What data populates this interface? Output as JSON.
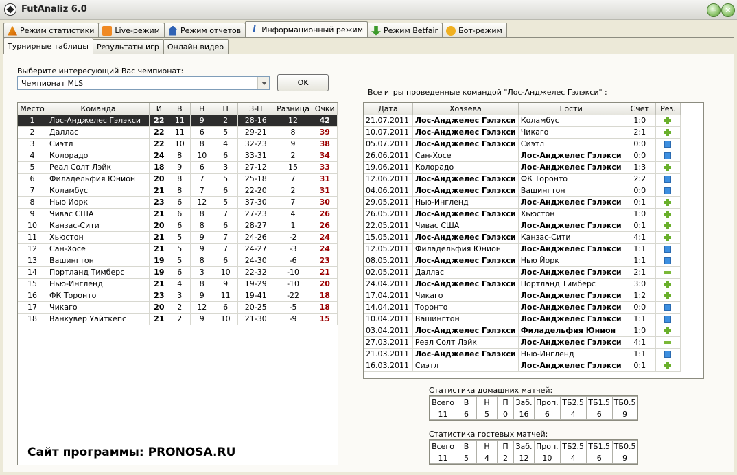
{
  "window": {
    "title": "FutAnaliz 6.0",
    "minimize": "−",
    "maximize": "+",
    "close": "×"
  },
  "main_tabs": [
    {
      "label": "Режим статистики",
      "icon": "warning-icon"
    },
    {
      "label": "Live-режим",
      "icon": "rss-icon"
    },
    {
      "label": "Режим отчетов",
      "icon": "home-icon"
    },
    {
      "label": "Информационный режим",
      "icon": "info-icon"
    },
    {
      "label": "Режим Betfair",
      "icon": "down-arrow-icon"
    },
    {
      "label": "Бот-режим",
      "icon": "chat-icon"
    }
  ],
  "sub_tabs": [
    {
      "label": "Турнирные таблицы"
    },
    {
      "label": "Результаты игр"
    },
    {
      "label": "Онлайн видео"
    }
  ],
  "championship": {
    "prompt": "Выберите интересующий Вас чемпионат:",
    "selected": "Чемпионат MLS",
    "ok_label": "OK"
  },
  "standings": {
    "headers": [
      "Место",
      "Команда",
      "И",
      "В",
      "Н",
      "П",
      "З-П",
      "Разница",
      "Очки"
    ],
    "rows": [
      [
        "1",
        "Лос-Анджелес Гэлэкси",
        "22",
        "11",
        "9",
        "2",
        "28-16",
        "12",
        "42"
      ],
      [
        "2",
        "Даллас",
        "22",
        "11",
        "6",
        "5",
        "29-21",
        "8",
        "39"
      ],
      [
        "3",
        "Сиэтл",
        "22",
        "10",
        "8",
        "4",
        "32-23",
        "9",
        "38"
      ],
      [
        "4",
        "Колорадо",
        "24",
        "8",
        "10",
        "6",
        "33-31",
        "2",
        "34"
      ],
      [
        "5",
        "Реал Солт Лэйк",
        "18",
        "9",
        "6",
        "3",
        "27-12",
        "15",
        "33"
      ],
      [
        "6",
        "Филадельфия Юнион",
        "20",
        "8",
        "7",
        "5",
        "25-18",
        "7",
        "31"
      ],
      [
        "7",
        "Коламбус",
        "21",
        "8",
        "7",
        "6",
        "22-20",
        "2",
        "31"
      ],
      [
        "8",
        "Нью Йорк",
        "23",
        "6",
        "12",
        "5",
        "37-30",
        "7",
        "30"
      ],
      [
        "9",
        "Чивас США",
        "21",
        "6",
        "8",
        "7",
        "27-23",
        "4",
        "26"
      ],
      [
        "10",
        "Канзас-Сити",
        "20",
        "6",
        "8",
        "6",
        "28-27",
        "1",
        "26"
      ],
      [
        "11",
        "Хьюстон",
        "21",
        "5",
        "9",
        "7",
        "24-26",
        "-2",
        "24"
      ],
      [
        "12",
        "Сан-Хосе",
        "21",
        "5",
        "9",
        "7",
        "24-27",
        "-3",
        "24"
      ],
      [
        "13",
        "Вашингтон",
        "19",
        "5",
        "8",
        "6",
        "24-30",
        "-6",
        "23"
      ],
      [
        "14",
        "Портланд Тимберс",
        "19",
        "6",
        "3",
        "10",
        "22-32",
        "-10",
        "21"
      ],
      [
        "15",
        "Нью-Ингленд",
        "21",
        "4",
        "8",
        "9",
        "19-29",
        "-10",
        "20"
      ],
      [
        "16",
        "ФК Торонто",
        "23",
        "3",
        "9",
        "11",
        "19-41",
        "-22",
        "18"
      ],
      [
        "17",
        "Чикаго",
        "20",
        "2",
        "12",
        "6",
        "20-25",
        "-5",
        "18"
      ],
      [
        "18",
        "Ванкувер Уайткепс",
        "21",
        "2",
        "9",
        "10",
        "21-30",
        "-9",
        "15"
      ]
    ]
  },
  "games": {
    "caption": "Все игры проведенные командой \"Лос-Анджелес Гэлэкси\" :",
    "headers": [
      "Дата",
      "Хозяева",
      "Гости",
      "Счет",
      "Рез."
    ],
    "rows": [
      {
        "date": "21.07.2011",
        "home": "Лос-Анджелес Гэлэкси",
        "away": "Коламбус",
        "score": "1:0",
        "result": "win",
        "bold": "home"
      },
      {
        "date": "10.07.2011",
        "home": "Лос-Анджелес Гэлэкси",
        "away": "Чикаго",
        "score": "2:1",
        "result": "win",
        "bold": "home"
      },
      {
        "date": "05.07.2011",
        "home": "Лос-Анджелес Гэлэкси",
        "away": "Сиэтл",
        "score": "0:0",
        "result": "draw",
        "bold": "home"
      },
      {
        "date": "26.06.2011",
        "home": "Сан-Хосе",
        "away": "Лос-Анджелес Гэлэкси",
        "score": "0:0",
        "result": "draw",
        "bold": "away"
      },
      {
        "date": "19.06.2011",
        "home": "Колорадо",
        "away": "Лос-Анджелес Гэлэкси",
        "score": "1:3",
        "result": "win",
        "bold": "away"
      },
      {
        "date": "12.06.2011",
        "home": "Лос-Анджелес Гэлэкси",
        "away": "ФК Торонто",
        "score": "2:2",
        "result": "draw",
        "bold": "home"
      },
      {
        "date": "04.06.2011",
        "home": "Лос-Анджелес Гэлэкси",
        "away": "Вашингтон",
        "score": "0:0",
        "result": "draw",
        "bold": "home"
      },
      {
        "date": "29.05.2011",
        "home": "Нью-Ингленд",
        "away": "Лос-Анджелес Гэлэкси",
        "score": "0:1",
        "result": "win",
        "bold": "away"
      },
      {
        "date": "26.05.2011",
        "home": "Лос-Анджелес Гэлэкси",
        "away": "Хьюстон",
        "score": "1:0",
        "result": "win",
        "bold": "home"
      },
      {
        "date": "22.05.2011",
        "home": "Чивас США",
        "away": "Лос-Анджелес Гэлэкси",
        "score": "0:1",
        "result": "win",
        "bold": "away"
      },
      {
        "date": "15.05.2011",
        "home": "Лос-Анджелес Гэлэкси",
        "away": "Канзас-Сити",
        "score": "4:1",
        "result": "win",
        "bold": "home"
      },
      {
        "date": "12.05.2011",
        "home": "Филадельфия Юнион",
        "away": "Лос-Анджелес Гэлэкси",
        "score": "1:1",
        "result": "draw",
        "bold": "away"
      },
      {
        "date": "08.05.2011",
        "home": "Лос-Анджелес Гэлэкси",
        "away": "Нью Йорк",
        "score": "1:1",
        "result": "draw",
        "bold": "home"
      },
      {
        "date": "02.05.2011",
        "home": "Даллас",
        "away": "Лос-Анджелес Гэлэкси",
        "score": "2:1",
        "result": "loss",
        "bold": "away"
      },
      {
        "date": "24.04.2011",
        "home": "Лос-Анджелес Гэлэкси",
        "away": "Портланд Тимберс",
        "score": "3:0",
        "result": "win",
        "bold": "home"
      },
      {
        "date": "17.04.2011",
        "home": "Чикаго",
        "away": "Лос-Анджелес Гэлэкси",
        "score": "1:2",
        "result": "win",
        "bold": "away"
      },
      {
        "date": "14.04.2011",
        "home": "Торонто",
        "away": "Лос-Анджелес Гэлэкси",
        "score": "0:0",
        "result": "draw",
        "bold": "away"
      },
      {
        "date": "10.04.2011",
        "home": "Вашингтон",
        "away": "Лос-Анджелес Гэлэкси",
        "score": "1:1",
        "result": "draw",
        "bold": "away"
      },
      {
        "date": "03.04.2011",
        "home": "Лос-Анджелес Гэлэкси",
        "away": "Филадельфия Юнион",
        "score": "1:0",
        "result": "win",
        "bold": "both"
      },
      {
        "date": "27.03.2011",
        "home": "Реал Солт Лэйк",
        "away": "Лос-Анджелес Гэлэкси",
        "score": "4:1",
        "result": "loss",
        "bold": "away"
      },
      {
        "date": "21.03.2011",
        "home": "Лос-Анджелес Гэлэкси",
        "away": "Нью-Ингленд",
        "score": "1:1",
        "result": "draw",
        "bold": "home"
      },
      {
        "date": "16.03.2011",
        "home": "Сиэтл",
        "away": "Лос-Анджелес Гэлэкси",
        "score": "0:1",
        "result": "win",
        "bold": "away"
      }
    ]
  },
  "home_stats": {
    "caption": "Статистика домашних матчей:",
    "headers": [
      "Всего",
      "В",
      "Н",
      "П",
      "Заб.",
      "Проп.",
      "ТБ2.5",
      "ТБ1.5",
      "ТБ0.5"
    ],
    "values": [
      "11",
      "6",
      "5",
      "0",
      "16",
      "6",
      "4",
      "6",
      "9"
    ]
  },
  "away_stats": {
    "caption": "Статистика гостевых матчей:",
    "headers": [
      "Всего",
      "В",
      "Н",
      "П",
      "Заб.",
      "Проп.",
      "ТБ2.5",
      "ТБ1.5",
      "ТБ0.5"
    ],
    "values": [
      "11",
      "5",
      "4",
      "2",
      "12",
      "10",
      "4",
      "6",
      "9"
    ]
  },
  "site_label": "Сайт программы: PRONOSA.RU",
  "colors": {
    "points": "#9a0000",
    "selected_row": "#2d2d2d",
    "win": "#6ab02c",
    "draw": "#3d8fe0"
  }
}
